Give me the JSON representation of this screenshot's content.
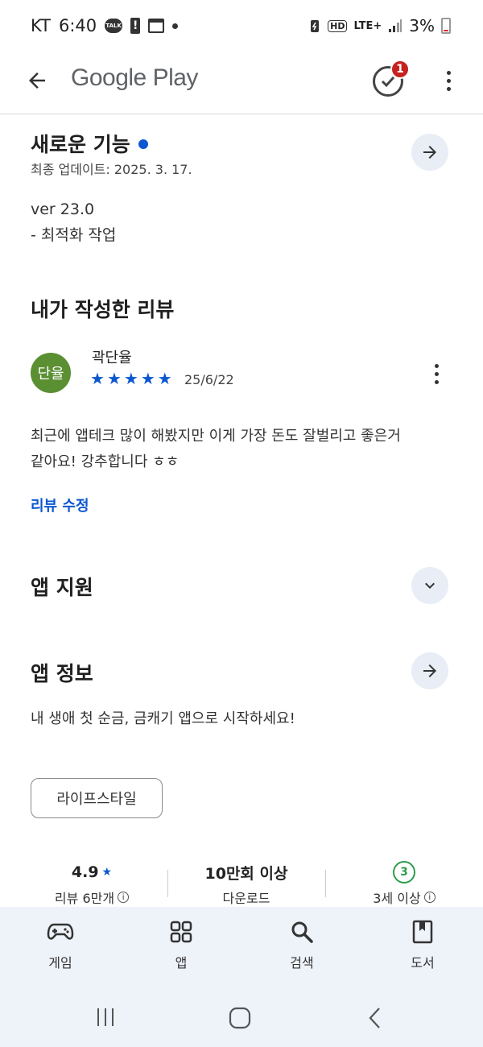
{
  "status": {
    "carrier": "KT",
    "time": "6:40",
    "talk_label": "TALK",
    "hd": "HD",
    "network": "LTE+",
    "battery": "3%"
  },
  "topbar": {
    "brand": "Google Play",
    "badge_count": "1"
  },
  "whats_new": {
    "title": "새로운 기능",
    "updated": "최종 업데이트: 2025. 3. 17.",
    "version": "ver 23.0",
    "note": "- 최적화 작업"
  },
  "my_review": {
    "title": "내가 작성한 리뷰",
    "avatar_text": "단율",
    "author": "곽단율",
    "date": "25/6/22",
    "rating": 5,
    "text_line1": "최근에 앱테크 많이 해봤지만 이게 가장 돈도 잘벌리고 좋은거",
    "text_line2": "같아요! 강추합니다 ㅎㅎ",
    "edit_link": "리뷰 수정"
  },
  "app_support": {
    "title": "앱 지원"
  },
  "app_info": {
    "title": "앱 정보",
    "description": "내 생애 첫 순금, 금캐기 앱으로 시작하세요!",
    "category_chip": "라이프스타일"
  },
  "stats": {
    "rating": "4.9",
    "reviews": "리뷰 6만개",
    "downloads": "10만회 이상",
    "downloads_label": "다운로드",
    "age_badge": "3",
    "age_label": "3세 이상"
  },
  "bottom_nav": [
    {
      "label": "게임",
      "icon": "gamepad-icon"
    },
    {
      "label": "앱",
      "icon": "apps-grid-icon"
    },
    {
      "label": "검색",
      "icon": "search-icon"
    },
    {
      "label": "도서",
      "icon": "book-icon"
    }
  ],
  "colors": {
    "accent": "#0b57d0",
    "badge": "#c5221f",
    "avatar": "#5a8f32",
    "age_green": "#2e9d4c",
    "nav_bg": "#eef2f9"
  }
}
